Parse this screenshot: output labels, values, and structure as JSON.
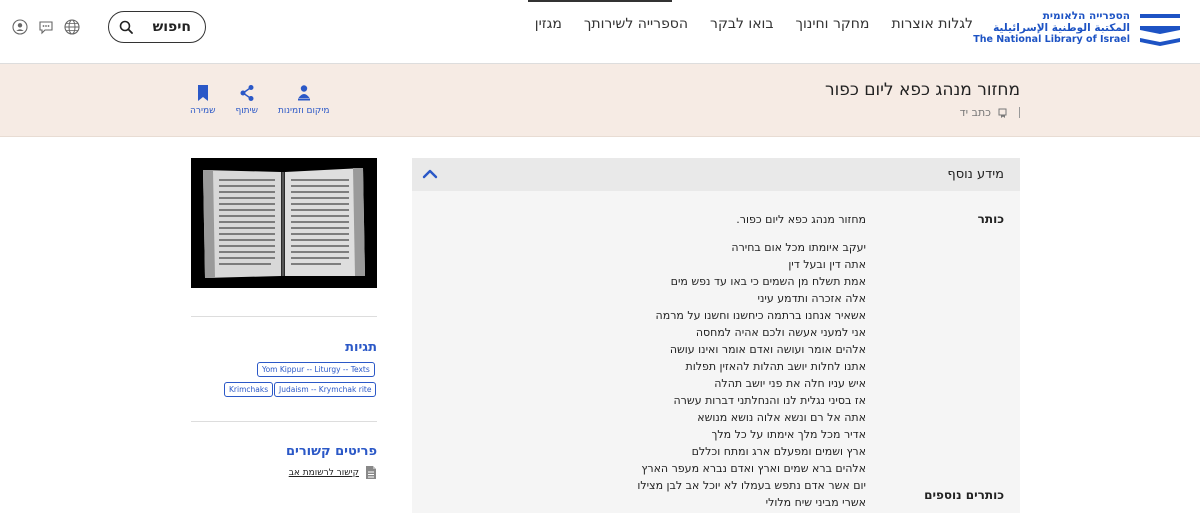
{
  "header": {
    "logo_he": "הספרייה הלאומית",
    "logo_ar": "المكتبة الوطنية الإسرائيلية",
    "logo_en": "The National Library of Israel",
    "nav": [
      "לגלות אוצרות",
      "מחקר וחינוך",
      "בואו לבקר",
      "הספרייה לשירותך",
      "מגזין"
    ],
    "search_label": "חיפוש"
  },
  "record": {
    "title": "מחזור מנהג כפא ליום כפור",
    "type": "כתב יד"
  },
  "actions": {
    "location": "מיקום וזמינות",
    "share": "שיתוף",
    "save": "שמירה"
  },
  "sidebar": {
    "tags_heading": "תגיות",
    "tags": [
      "Yom Kippur -- Liturgy -- Texts",
      "Judaism -- Krymchak rite",
      "Krimchaks"
    ],
    "related_heading": "פריטים קשורים",
    "related_link": "קישור לרשומת אב"
  },
  "info": {
    "heading": "מידע נוסף",
    "title_label": "כותר",
    "title_value": "מחזור מנהג כפא ליום כפור.",
    "other_titles_label": "כותרים נוספים",
    "other_titles": [
      "יעקב איומתו מכל אום בחירה",
      "אתה דין ובעל דין",
      "אמת תשלח מן השמים כי באו עד נפש מים",
      "אלה אזכרה ותדמע עיני",
      "אשאיר אנחנו ברתמה כיחשנו וחשנו על מרמה",
      "אני למעני אעשה ולכם אהיה למחסה",
      "אלהים אומר ועושה ואדם אומר ואינו עושה",
      "אתנו לחלות יושב תהלות להאזין תפלות",
      "איש עניו חלה את פני יושב תהלה",
      "אז בסיני נגלית לנו והנחלתני דברות עשרה",
      "אתה אל רם ונשא אלוה נושא מנושא",
      "אדיר מכל מלך אימתו על כל מלך",
      "ארץ ושמים ומפעלם ארג ומתח וכללם",
      "אלהים ברא שמים וארץ ואדם נברא מעפר הארץ",
      "יום אשר אדם נתפש בעמלו לא יוכל אב לבן מצילו",
      "אשרי מביני שיח מלולי"
    ]
  },
  "colors": {
    "accent": "#2b58c7",
    "band": "#f6ebe4"
  }
}
